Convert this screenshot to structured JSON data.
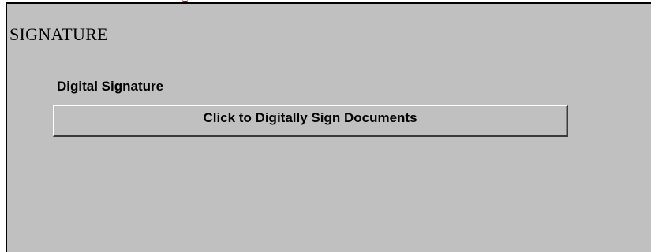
{
  "section": {
    "title": "SIGNATURE"
  },
  "digital_signature": {
    "label": "Digital Signature",
    "button_label": "Click to Digitally Sign Documents"
  },
  "colors": {
    "panel_background": "#c0c0c0",
    "panel_border": "#000000",
    "red_mark": "#cc0000"
  }
}
